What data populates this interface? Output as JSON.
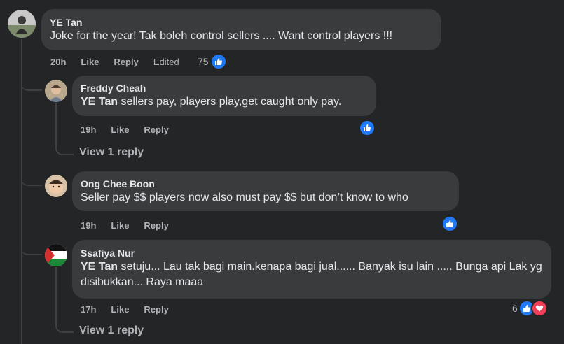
{
  "comments": [
    {
      "author": "YE Tan",
      "text": "Joke for the year! Tak boleh control sellers .... Want control players !!!",
      "time": "20h",
      "like_label": "Like",
      "reply_label": "Reply",
      "edited_label": "Edited",
      "reaction_count": "75",
      "reactions": [
        "like-icon"
      ]
    },
    {
      "author": "Freddy Cheah",
      "mention": "YE Tan",
      "text": " sellers pay, players play,get caught only pay.",
      "time": "19h",
      "like_label": "Like",
      "reply_label": "Reply",
      "reactions": [
        "like-icon"
      ],
      "view_replies": "View 1 reply"
    },
    {
      "author": "Ong Chee Boon",
      "text": "Seller pay $$ players now also must pay $$ but don’t know to who",
      "time": "19h",
      "like_label": "Like",
      "reply_label": "Reply",
      "reactions": [
        "like-icon"
      ]
    },
    {
      "author": "Ssafiya Nur",
      "mention": "YE Tan",
      "text": " setuju... Lau tak bagi main.kenapa bagi jual...... Banyak isu lain ..... Bunga api Lak yg disibukkan... Raya maaa",
      "time": "17h",
      "like_label": "Like",
      "reply_label": "Reply",
      "reaction_count": "6",
      "reactions": [
        "like-icon",
        "heart-icon"
      ],
      "view_replies": "View 1 reply"
    }
  ],
  "colors": {
    "background": "#242526",
    "bubble": "#3a3b3c",
    "like_blue": "#2078f4",
    "heart_red": "#f33e58"
  }
}
